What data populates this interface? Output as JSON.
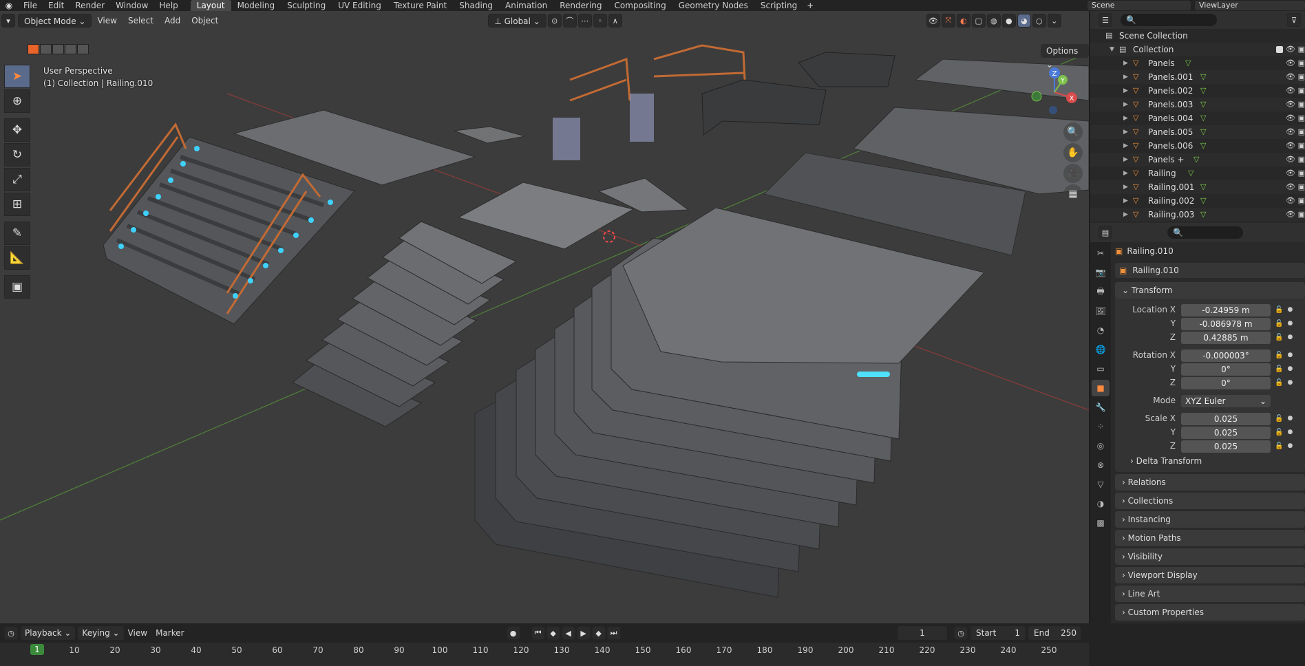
{
  "topbar": {
    "menus": [
      "File",
      "Edit",
      "Render",
      "Window",
      "Help"
    ],
    "workspaces": [
      "Layout",
      "Modeling",
      "Sculpting",
      "UV Editing",
      "Texture Paint",
      "Shading",
      "Animation",
      "Rendering",
      "Compositing",
      "Geometry Nodes",
      "Scripting"
    ],
    "active_workspace": "Layout",
    "scene": "Scene",
    "view_layer": "ViewLayer"
  },
  "viewport": {
    "mode": "Object Mode",
    "menus": [
      "View",
      "Select",
      "Add",
      "Object"
    ],
    "orientation": "Global",
    "options": "Options",
    "overlay_line1": "User Perspective",
    "overlay_line2": "(1) Collection | Railing.010",
    "gizmo": {
      "x": "X",
      "y": "Y",
      "z": "Z"
    }
  },
  "outliner": {
    "scene_collection": "Scene Collection",
    "collection": "Collection",
    "items": [
      "Panels",
      "Panels.001",
      "Panels.002",
      "Panels.003",
      "Panels.004",
      "Panels.005",
      "Panels.006",
      "Panels +",
      "Railing",
      "Railing.001",
      "Railing.002",
      "Railing.003"
    ]
  },
  "properties": {
    "object_name": "Railing.010",
    "object_field": "Railing.010",
    "transform_label": "Transform",
    "location_label": "Location X",
    "location": [
      "-0.24959 m",
      "-0.086978 m",
      "0.42885 m"
    ],
    "rotation_label": "Rotation X",
    "rotation": [
      "-0.000003°",
      "0°",
      "0°"
    ],
    "mode_label": "Mode",
    "mode_value": "XYZ Euler",
    "scale_label": "Scale X",
    "scale": [
      "0.025",
      "0.025",
      "0.025"
    ],
    "axis_y": "Y",
    "axis_z": "Z",
    "delta_transform": "Delta Transform",
    "panels": [
      "Relations",
      "Collections",
      "Instancing",
      "Motion Paths",
      "Visibility",
      "Viewport Display",
      "Line Art",
      "Custom Properties"
    ]
  },
  "timeline": {
    "playback": "Playback",
    "keying": "Keying",
    "view": "View",
    "marker": "Marker",
    "current_frame": "1",
    "start_label": "Start",
    "start": "1",
    "end_label": "End",
    "end": "250",
    "ruler_current": "1",
    "ticks": [
      "10",
      "20",
      "30",
      "40",
      "50",
      "60",
      "70",
      "80",
      "90",
      "100",
      "110",
      "120",
      "130",
      "140",
      "150",
      "160",
      "170",
      "180",
      "190",
      "200",
      "210",
      "220",
      "230",
      "240",
      "250"
    ]
  },
  "colors": {
    "accent_orange": "#e8642a",
    "object_orange": "#f0913a",
    "mesh_green": "#7ed04a",
    "timeline_green": "#3b8a3b"
  }
}
